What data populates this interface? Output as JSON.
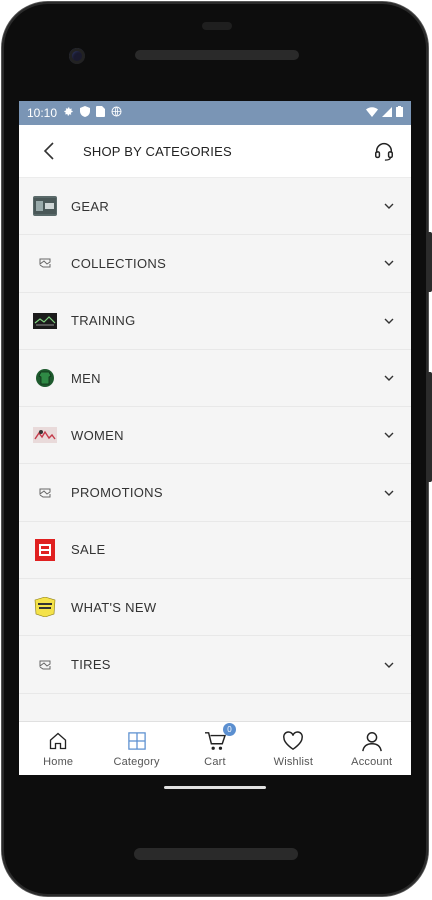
{
  "status_bar": {
    "time": "10:10"
  },
  "header": {
    "title": "SHOP BY CATEGORIES"
  },
  "categories": [
    {
      "label": "GEAR",
      "thumb": "gear-thumb",
      "has_chevron": true
    },
    {
      "label": "COLLECTIONS",
      "thumb": "broken-image",
      "has_chevron": true
    },
    {
      "label": "TRAINING",
      "thumb": "training-thumb",
      "has_chevron": true
    },
    {
      "label": "MEN",
      "thumb": "men-thumb",
      "has_chevron": true
    },
    {
      "label": "WOMEN",
      "thumb": "women-thumb",
      "has_chevron": true
    },
    {
      "label": "PROMOTIONS",
      "thumb": "broken-image",
      "has_chevron": true
    },
    {
      "label": "SALE",
      "thumb": "sale-thumb",
      "has_chevron": false
    },
    {
      "label": "WHAT'S NEW",
      "thumb": "whats-new-thumb",
      "has_chevron": false
    },
    {
      "label": "TIRES",
      "thumb": "broken-image",
      "has_chevron": true
    }
  ],
  "bottom_nav": {
    "home": "Home",
    "category": "Category",
    "cart": "Cart",
    "cart_count": "0",
    "wishlist": "Wishlist",
    "account": "Account"
  },
  "colors": {
    "status_bar": "#7a95b5",
    "active_nav": "#5b8fd0",
    "sale_red": "#e02020",
    "whats_new_yellow": "#f4e24a"
  }
}
